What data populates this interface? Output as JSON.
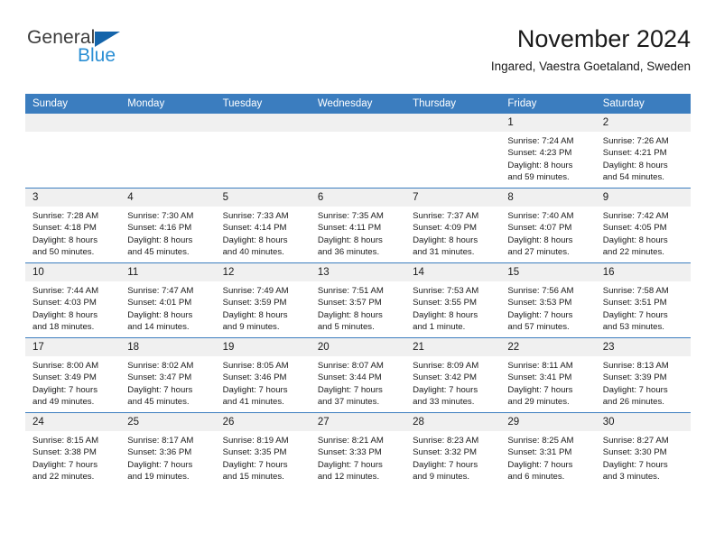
{
  "brand": {
    "name_top": "General",
    "name_bottom": "Blue",
    "triangle_color": "#1464aa",
    "top_color": "#3c3c3c",
    "bottom_color": "#2b8fd4"
  },
  "header": {
    "title": "November 2024",
    "subtitle": "Ingared, Vaestra Goetaland, Sweden"
  },
  "theme": {
    "header_bg": "#3b7dbf",
    "header_text": "#ffffff",
    "daynum_bg": "#f0f0f0",
    "grid_line": "#3b7dbf",
    "page_bg": "#ffffff"
  },
  "calendar": {
    "weekday_headers": [
      "Sunday",
      "Monday",
      "Tuesday",
      "Wednesday",
      "Thursday",
      "Friday",
      "Saturday"
    ],
    "weeks": [
      [
        {
          "day": "",
          "empty": true
        },
        {
          "day": "",
          "empty": true
        },
        {
          "day": "",
          "empty": true
        },
        {
          "day": "",
          "empty": true
        },
        {
          "day": "",
          "empty": true
        },
        {
          "day": "1",
          "sunrise": "Sunrise: 7:24 AM",
          "sunset": "Sunset: 4:23 PM",
          "daylight_1": "Daylight: 8 hours",
          "daylight_2": "and 59 minutes."
        },
        {
          "day": "2",
          "sunrise": "Sunrise: 7:26 AM",
          "sunset": "Sunset: 4:21 PM",
          "daylight_1": "Daylight: 8 hours",
          "daylight_2": "and 54 minutes."
        }
      ],
      [
        {
          "day": "3",
          "sunrise": "Sunrise: 7:28 AM",
          "sunset": "Sunset: 4:18 PM",
          "daylight_1": "Daylight: 8 hours",
          "daylight_2": "and 50 minutes."
        },
        {
          "day": "4",
          "sunrise": "Sunrise: 7:30 AM",
          "sunset": "Sunset: 4:16 PM",
          "daylight_1": "Daylight: 8 hours",
          "daylight_2": "and 45 minutes."
        },
        {
          "day": "5",
          "sunrise": "Sunrise: 7:33 AM",
          "sunset": "Sunset: 4:14 PM",
          "daylight_1": "Daylight: 8 hours",
          "daylight_2": "and 40 minutes."
        },
        {
          "day": "6",
          "sunrise": "Sunrise: 7:35 AM",
          "sunset": "Sunset: 4:11 PM",
          "daylight_1": "Daylight: 8 hours",
          "daylight_2": "and 36 minutes."
        },
        {
          "day": "7",
          "sunrise": "Sunrise: 7:37 AM",
          "sunset": "Sunset: 4:09 PM",
          "daylight_1": "Daylight: 8 hours",
          "daylight_2": "and 31 minutes."
        },
        {
          "day": "8",
          "sunrise": "Sunrise: 7:40 AM",
          "sunset": "Sunset: 4:07 PM",
          "daylight_1": "Daylight: 8 hours",
          "daylight_2": "and 27 minutes."
        },
        {
          "day": "9",
          "sunrise": "Sunrise: 7:42 AM",
          "sunset": "Sunset: 4:05 PM",
          "daylight_1": "Daylight: 8 hours",
          "daylight_2": "and 22 minutes."
        }
      ],
      [
        {
          "day": "10",
          "sunrise": "Sunrise: 7:44 AM",
          "sunset": "Sunset: 4:03 PM",
          "daylight_1": "Daylight: 8 hours",
          "daylight_2": "and 18 minutes."
        },
        {
          "day": "11",
          "sunrise": "Sunrise: 7:47 AM",
          "sunset": "Sunset: 4:01 PM",
          "daylight_1": "Daylight: 8 hours",
          "daylight_2": "and 14 minutes."
        },
        {
          "day": "12",
          "sunrise": "Sunrise: 7:49 AM",
          "sunset": "Sunset: 3:59 PM",
          "daylight_1": "Daylight: 8 hours",
          "daylight_2": "and 9 minutes."
        },
        {
          "day": "13",
          "sunrise": "Sunrise: 7:51 AM",
          "sunset": "Sunset: 3:57 PM",
          "daylight_1": "Daylight: 8 hours",
          "daylight_2": "and 5 minutes."
        },
        {
          "day": "14",
          "sunrise": "Sunrise: 7:53 AM",
          "sunset": "Sunset: 3:55 PM",
          "daylight_1": "Daylight: 8 hours",
          "daylight_2": "and 1 minute."
        },
        {
          "day": "15",
          "sunrise": "Sunrise: 7:56 AM",
          "sunset": "Sunset: 3:53 PM",
          "daylight_1": "Daylight: 7 hours",
          "daylight_2": "and 57 minutes."
        },
        {
          "day": "16",
          "sunrise": "Sunrise: 7:58 AM",
          "sunset": "Sunset: 3:51 PM",
          "daylight_1": "Daylight: 7 hours",
          "daylight_2": "and 53 minutes."
        }
      ],
      [
        {
          "day": "17",
          "sunrise": "Sunrise: 8:00 AM",
          "sunset": "Sunset: 3:49 PM",
          "daylight_1": "Daylight: 7 hours",
          "daylight_2": "and 49 minutes."
        },
        {
          "day": "18",
          "sunrise": "Sunrise: 8:02 AM",
          "sunset": "Sunset: 3:47 PM",
          "daylight_1": "Daylight: 7 hours",
          "daylight_2": "and 45 minutes."
        },
        {
          "day": "19",
          "sunrise": "Sunrise: 8:05 AM",
          "sunset": "Sunset: 3:46 PM",
          "daylight_1": "Daylight: 7 hours",
          "daylight_2": "and 41 minutes."
        },
        {
          "day": "20",
          "sunrise": "Sunrise: 8:07 AM",
          "sunset": "Sunset: 3:44 PM",
          "daylight_1": "Daylight: 7 hours",
          "daylight_2": "and 37 minutes."
        },
        {
          "day": "21",
          "sunrise": "Sunrise: 8:09 AM",
          "sunset": "Sunset: 3:42 PM",
          "daylight_1": "Daylight: 7 hours",
          "daylight_2": "and 33 minutes."
        },
        {
          "day": "22",
          "sunrise": "Sunrise: 8:11 AM",
          "sunset": "Sunset: 3:41 PM",
          "daylight_1": "Daylight: 7 hours",
          "daylight_2": "and 29 minutes."
        },
        {
          "day": "23",
          "sunrise": "Sunrise: 8:13 AM",
          "sunset": "Sunset: 3:39 PM",
          "daylight_1": "Daylight: 7 hours",
          "daylight_2": "and 26 minutes."
        }
      ],
      [
        {
          "day": "24",
          "sunrise": "Sunrise: 8:15 AM",
          "sunset": "Sunset: 3:38 PM",
          "daylight_1": "Daylight: 7 hours",
          "daylight_2": "and 22 minutes."
        },
        {
          "day": "25",
          "sunrise": "Sunrise: 8:17 AM",
          "sunset": "Sunset: 3:36 PM",
          "daylight_1": "Daylight: 7 hours",
          "daylight_2": "and 19 minutes."
        },
        {
          "day": "26",
          "sunrise": "Sunrise: 8:19 AM",
          "sunset": "Sunset: 3:35 PM",
          "daylight_1": "Daylight: 7 hours",
          "daylight_2": "and 15 minutes."
        },
        {
          "day": "27",
          "sunrise": "Sunrise: 8:21 AM",
          "sunset": "Sunset: 3:33 PM",
          "daylight_1": "Daylight: 7 hours",
          "daylight_2": "and 12 minutes."
        },
        {
          "day": "28",
          "sunrise": "Sunrise: 8:23 AM",
          "sunset": "Sunset: 3:32 PM",
          "daylight_1": "Daylight: 7 hours",
          "daylight_2": "and 9 minutes."
        },
        {
          "day": "29",
          "sunrise": "Sunrise: 8:25 AM",
          "sunset": "Sunset: 3:31 PM",
          "daylight_1": "Daylight: 7 hours",
          "daylight_2": "and 6 minutes."
        },
        {
          "day": "30",
          "sunrise": "Sunrise: 8:27 AM",
          "sunset": "Sunset: 3:30 PM",
          "daylight_1": "Daylight: 7 hours",
          "daylight_2": "and 3 minutes."
        }
      ]
    ]
  }
}
